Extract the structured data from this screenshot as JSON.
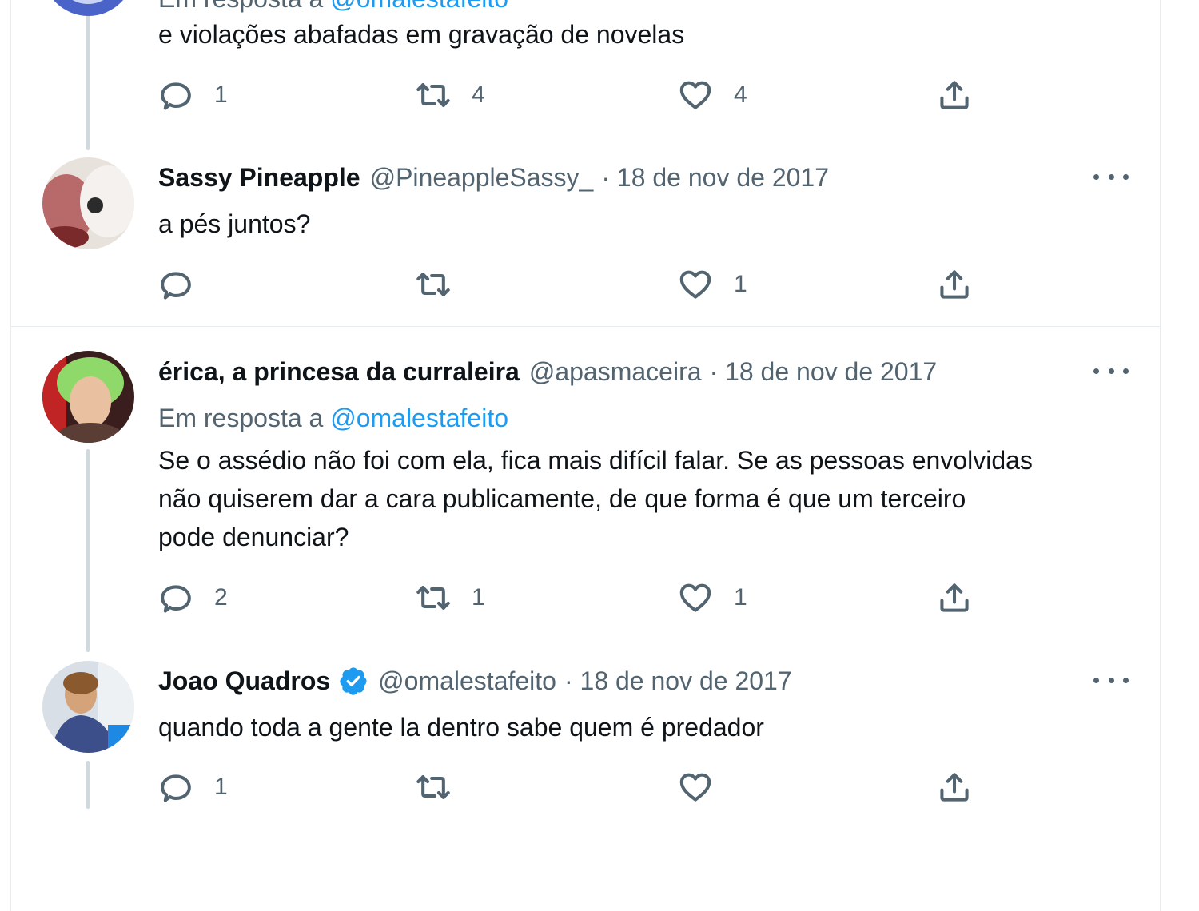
{
  "tweets": [
    {
      "reply_prefix": "Em resposta a",
      "reply_mention": "@omalestafeito",
      "text": "e violações abafadas em gravação de novelas",
      "replies": "1",
      "retweets": "4",
      "likes": "4"
    },
    {
      "name": "Sassy Pineapple",
      "handle": "@PineappleSassy_",
      "date": "· 18 de nov de 2017",
      "text": "a pés juntos?",
      "replies": "",
      "retweets": "",
      "likes": "1"
    },
    {
      "name": "érica, a princesa da curraleira",
      "handle": "@apasmaceira",
      "date": "· 18 de nov de 2017",
      "reply_prefix": "Em resposta a",
      "reply_mention": "@omalestafeito",
      "text": "Se o assédio não foi com ela, fica mais difícil falar. Se as pessoas envolvidas\nnão quiserem dar a cara publicamente, de que forma é que um terceiro\npode denunciar?",
      "replies": "2",
      "retweets": "1",
      "likes": "1"
    },
    {
      "name": "Joao Quadros",
      "verified": true,
      "handle": "@omalestafeito",
      "date": "· 18 de nov de 2017",
      "text": "quando toda a gente la dentro sabe quem é predador",
      "replies": "1",
      "retweets": "",
      "likes": ""
    }
  ],
  "icons": {
    "reply": "reply-icon",
    "retweet": "retweet-icon",
    "like": "heart-icon",
    "share": "share-icon",
    "more": "more-icon",
    "verified": "verified-badge-icon"
  },
  "colors": {
    "link": "#1d9bf0",
    "secondary_text": "#536471",
    "thread_line": "#cfd9de",
    "border": "#e6ecf0"
  }
}
